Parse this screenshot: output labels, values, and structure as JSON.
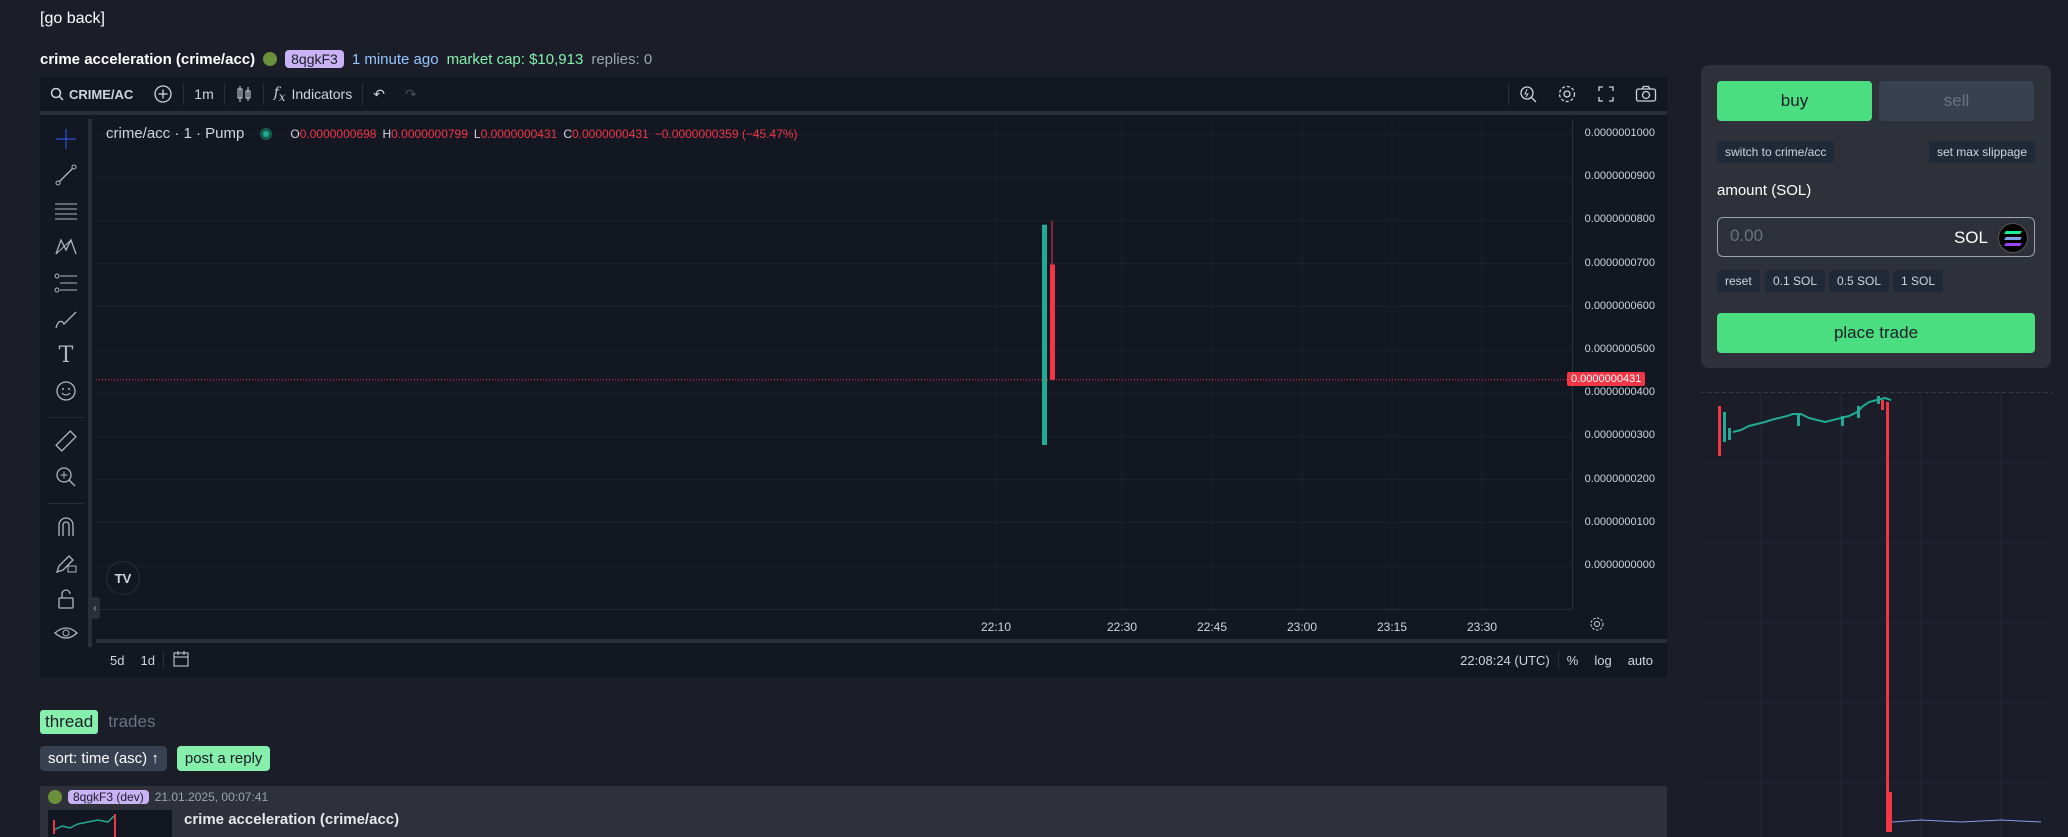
{
  "nav": {
    "go_back": "[go back]"
  },
  "token": {
    "name": "crime acceleration (crime/acc)",
    "creator": "8qgkF3",
    "created_ago": "1 minute ago",
    "market_cap": "market cap: $10,913",
    "replies": "replies: 0"
  },
  "chart_toolbar": {
    "symbol": "CRIME/AC",
    "interval": "1m",
    "indicators": "Indicators"
  },
  "chart_legend": {
    "title": "crime/acc · 1 · Pump",
    "o_label": "O",
    "o_value": "0.0000000698",
    "h_label": "H",
    "h_value": "0.0000000799",
    "l_label": "L",
    "l_value": "0.0000000431",
    "c_label": "C",
    "c_value": "0.0000000431",
    "change": "−0.0000000359 (−45.47%)"
  },
  "chart_bottom": {
    "range_5d": "5d",
    "range_1d": "1d",
    "clock": "22:08:24 (UTC)",
    "percent": "%",
    "log": "log",
    "auto": "auto"
  },
  "chart_data": {
    "type": "candlestick",
    "y_ticks": [
      "0.0000001000",
      "0.0000000900",
      "0.0000000800",
      "0.0000000700",
      "0.0000000600",
      "0.0000000500",
      "0.0000000400",
      "0.0000000300",
      "0.0000000200",
      "0.0000000100",
      "0.0000000000"
    ],
    "x_ticks": [
      "22:10",
      "22:30",
      "22:45",
      "23:00",
      "23:15",
      "23:30"
    ],
    "ylim": [
      0,
      1e-07
    ],
    "last_price_label": "0.0000000431",
    "last_price": 4.31e-08,
    "candles": [
      {
        "open": 2.8e-08,
        "high": 7.9e-08,
        "low": 2.8e-08,
        "close": 7.9e-08,
        "color": "#22ab94"
      },
      {
        "open": 6.98e-08,
        "high": 7.99e-08,
        "low": 4.31e-08,
        "close": 4.31e-08,
        "color": "#f23645"
      }
    ],
    "grid": true
  },
  "trade_panel": {
    "buy": "buy",
    "sell": "sell",
    "switch": "switch to crime/acc",
    "max_slippage": "set max slippage",
    "amount_label": "amount (SOL)",
    "amount_placeholder": "0.00",
    "unit": "SOL",
    "reset": "reset",
    "preset1": "0.1 SOL",
    "preset2": "0.5 SOL",
    "preset3": "1 SOL",
    "place_trade": "place trade"
  },
  "thread": {
    "tab_thread": "thread",
    "tab_trades": "trades",
    "sort": "sort: time (asc) ↑",
    "post_reply": "post a reply",
    "post": {
      "author": "8qgkF3 (dev)",
      "timestamp": "21.01.2025, 00:07:41",
      "title": "crime acceleration (crime/acc)"
    }
  },
  "colors": {
    "up": "#22ab94",
    "down": "#f23645",
    "accent": "#4ade80",
    "panel": "#2e303a",
    "background": "#1b1d28"
  }
}
